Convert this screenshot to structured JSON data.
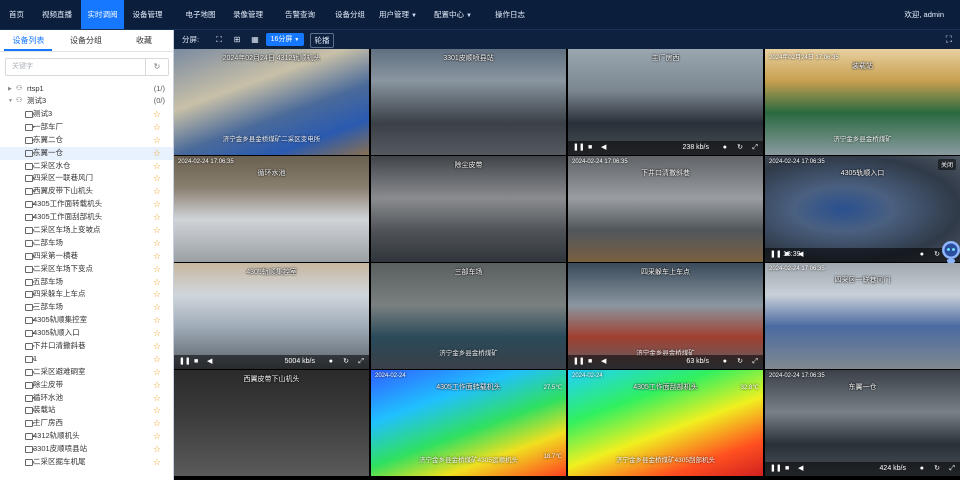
{
  "nav": {
    "items": [
      {
        "label": "首页",
        "has_caret": false
      },
      {
        "label": "视频直播",
        "has_caret": false
      },
      {
        "label": "实时调阅",
        "has_caret": false
      },
      {
        "label": "设备管理",
        "has_caret": false
      },
      {
        "label": "电子地图",
        "has_caret": false
      },
      {
        "label": "录像管理",
        "has_caret": false
      },
      {
        "label": "告警查询",
        "has_caret": false
      },
      {
        "label": "设备分组",
        "has_caret": false
      },
      {
        "label": "用户管理",
        "has_caret": true
      },
      {
        "label": "配置中心",
        "has_caret": true
      },
      {
        "label": "操作日志",
        "has_caret": false
      }
    ],
    "active_index": 2,
    "user": "欢迎, admin"
  },
  "sidebar": {
    "tabs": [
      "设备列表",
      "设备分组",
      "收藏"
    ],
    "active_tab": 0,
    "search_placeholder": "关键字",
    "groups": [
      {
        "label": "rtsp1",
        "count": "(1/)"
      },
      {
        "label": "测试3",
        "count": "(0/)"
      }
    ],
    "devices": [
      "测试3",
      "一部车厂",
      "东翼二仓",
      "东翼一仓",
      "二采区水仓",
      "四采区一联巷风门",
      "西翼皮带下山机头",
      "4305工作面转载机头",
      "4305工作面刮部机头",
      "二采区车场上变坡点",
      "二部车场",
      "四采第一横巷",
      "二采区车场下变点",
      "五部车场",
      "四采躲车上车点",
      "三部车场",
      "4305轨顺集控室",
      "4305轨顺入口",
      "下井口清撒斜巷",
      "1",
      "二采区避难硐室",
      "除尘皮带",
      "循环水池",
      "装载站",
      "主厂房西",
      "4312轨顺机头",
      "3301皮顺喷县站",
      "二采区掘车机尾"
    ],
    "selected_device": 3
  },
  "toolbar": {
    "split_label": "分屏:",
    "split_select": "16分屏",
    "carousel": "轮播"
  },
  "colors": {
    "nav_bg": "#0b1e3c",
    "accent": "#1677ff",
    "star": "#f0a020",
    "selected_border": "#e02020"
  },
  "cells": [
    {
      "title": "2024年02月24日 4312轨顺机头",
      "watermark": "济宁金乡县金桥煤矿二采区变电所",
      "ts": "",
      "ctrl": "",
      "temp_top": "",
      "temp_bottom": "",
      "close": ""
    },
    {
      "title": "3301皮顺喷县站",
      "watermark": "",
      "ts": "",
      "ctrl": "",
      "temp_top": "",
      "temp_bottom": "",
      "close": ""
    },
    {
      "title": "主厂房西",
      "watermark": "",
      "ts": "",
      "ctrl": "238 kb/s",
      "temp_top": "",
      "temp_bottom": "",
      "close": ""
    },
    {
      "title": "装载站",
      "watermark": "济宁金乡县金桥煤矿",
      "ts": "2024年02月24日 17:06:35",
      "ctrl": "",
      "temp_top": "",
      "temp_bottom": "",
      "close": ""
    },
    {
      "title": "循环水池",
      "watermark": "",
      "ts": "2024-02-24 17:06:35",
      "ctrl": "",
      "temp_top": "",
      "temp_bottom": "",
      "close": ""
    },
    {
      "title": "除尘皮带",
      "watermark": "",
      "ts": "",
      "ctrl": "",
      "temp_top": "",
      "temp_bottom": "",
      "close": ""
    },
    {
      "title": "下井口清撒斜巷",
      "watermark": "",
      "ts": "2024-02-24 17:06:35",
      "ctrl": "",
      "temp_top": "",
      "temp_bottom": "",
      "close": ""
    },
    {
      "title": "4305轨顺入口",
      "watermark": "",
      "ts": "2024-02-24 17:06:35",
      "ctrl": "18:39",
      "temp_top": "",
      "temp_bottom": "",
      "close": "关闭"
    },
    {
      "title": "4305轨顺集控室",
      "watermark": "",
      "ts": "",
      "ctrl": "5004 kb/s",
      "temp_top": "",
      "temp_bottom": "",
      "close": ""
    },
    {
      "title": "三部车场",
      "watermark": "济宁金乡县金桥煤矿",
      "ts": "",
      "ctrl": "",
      "temp_top": "",
      "temp_bottom": "",
      "close": ""
    },
    {
      "title": "四采躲车上车点",
      "watermark": "济宁金乡县金桥煤矿",
      "ts": "",
      "ctrl": "63 kb/s",
      "temp_top": "",
      "temp_bottom": "",
      "close": ""
    },
    {
      "title": "四采区一联巷风门",
      "watermark": "",
      "ts": "2024-02-24 17:06:35",
      "ctrl": "",
      "temp_top": "",
      "temp_bottom": "",
      "close": ""
    },
    {
      "title": "西翼皮带下山机头",
      "watermark": "",
      "ts": "",
      "ctrl": "",
      "temp_top": "",
      "temp_bottom": "",
      "close": ""
    },
    {
      "title": "4305工作面转载机头",
      "watermark": "济宁金乡县金桥煤矿4305运顺机头",
      "ts": "2024-02-24",
      "ctrl": "",
      "temp_top": "27.5℃",
      "temp_bottom": "18.7℃",
      "close": ""
    },
    {
      "title": "4305工作面刮部机头",
      "watermark": "济宁金乡县金桥煤矿4305刮部机头",
      "ts": "2024-02-24",
      "ctrl": "",
      "temp_top": "32.8℃",
      "temp_bottom": "",
      "close": ""
    },
    {
      "title": "东翼一仓",
      "watermark": "",
      "ts": "2024-02-24 17:06:35",
      "ctrl": "424 kb/s",
      "temp_top": "",
      "temp_bottom": "",
      "close": ""
    }
  ]
}
